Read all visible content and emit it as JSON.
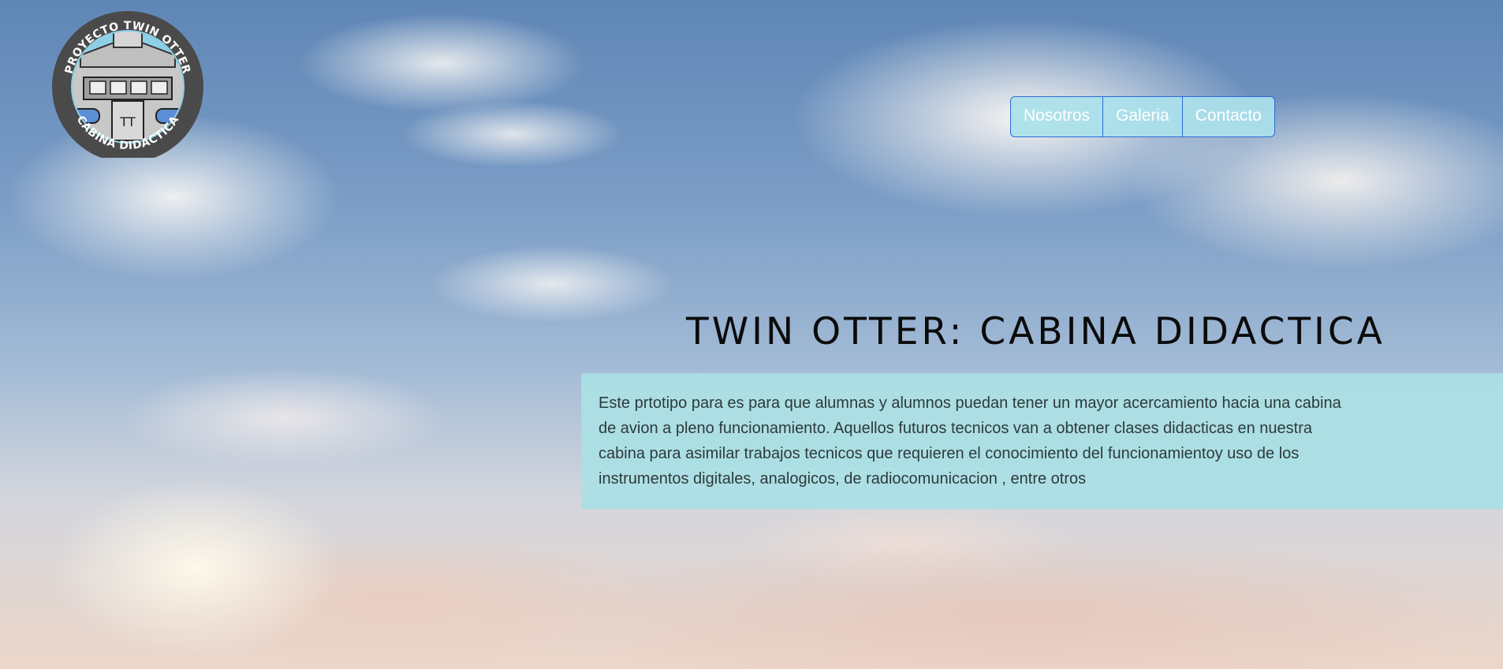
{
  "logo": {
    "top_text": "PROYECTO TWIN OTTER",
    "bottom_text": "CABINA DIDACTICA",
    "center_text": "TT"
  },
  "nav": {
    "items": [
      {
        "label": "Nosotros"
      },
      {
        "label": "Galeria"
      },
      {
        "label": "Contacto"
      }
    ]
  },
  "hero": {
    "title": "TWIN OTTER: CABINA DIDACTICA",
    "description": "Este prtotipo para es para que alumnas y alumnos puedan tener un mayor acercamiento hacia una cabina de avion a pleno funcionamiento. Aquellos futuros tecnicos van a obtener clases didacticas en nuestra cabina para asimilar trabajos tecnicos que requieren el conocimiento del funcionamientoy uso de los instrumentos digitales, analogicos, de radiocomunicacion , entre otros"
  },
  "colors": {
    "nav_bg": "#aae1ea",
    "nav_border": "#2e6ad8",
    "desc_bg": "#abdfe4",
    "title_text": "#0b0b0b"
  },
  "icons": {
    "logo": "cockpit-badge-logo"
  }
}
